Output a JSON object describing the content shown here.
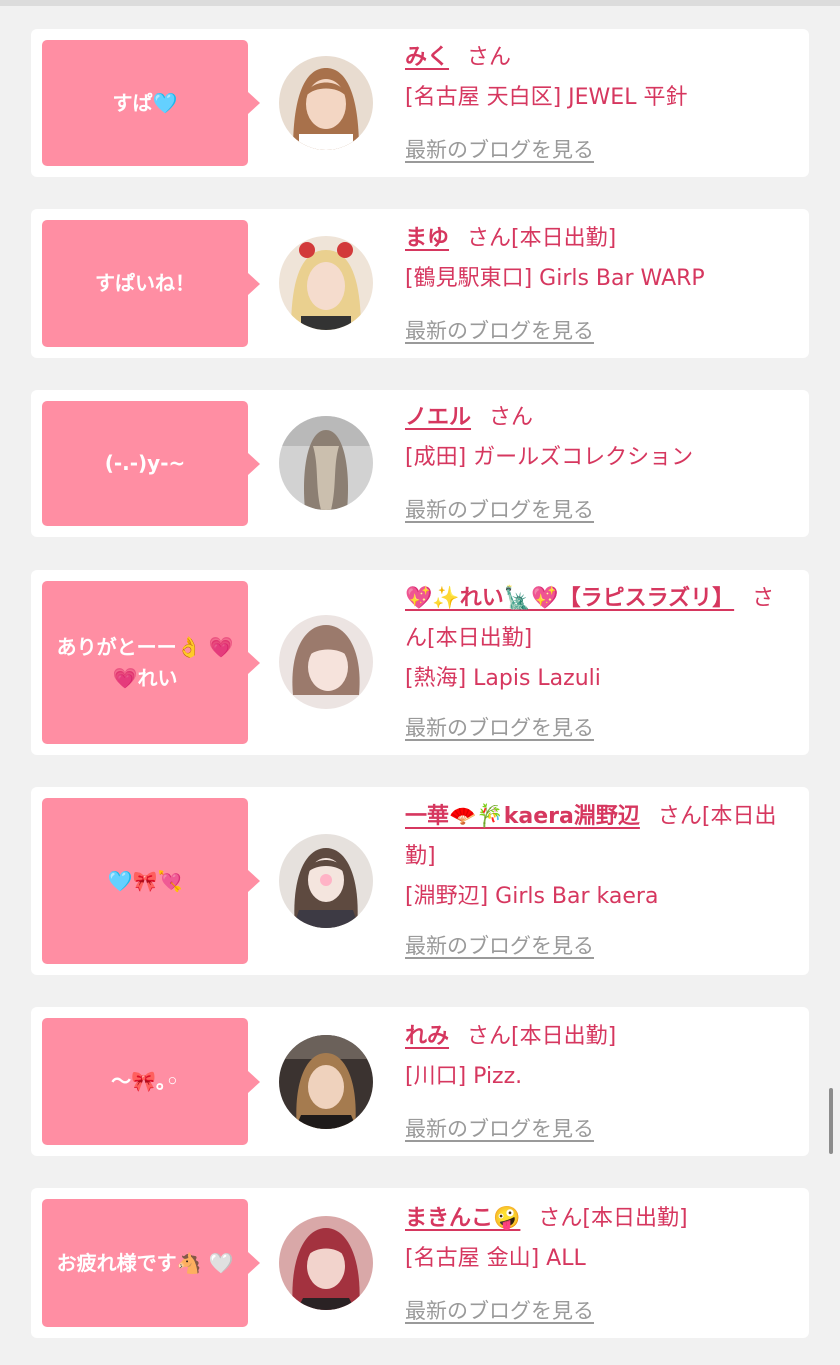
{
  "entries": [
    {
      "message": "すぱ🩵",
      "name": "みく",
      "honorific": "さん",
      "status": "",
      "shop": "[名古屋 天白区] JEWEL 平針",
      "blog_link": "最新のブログを見る",
      "avatar_colors": {
        "bg": "#e8dcd0",
        "hair": "#a8714b",
        "face": "#f3d6c3"
      }
    },
    {
      "message": "すぱいね！",
      "name": "まゆ",
      "honorific": "さん",
      "status": "[本日出勤]",
      "shop": "[鶴見駅東口] Girls Bar WARP",
      "blog_link": "最新のブログを見る",
      "avatar_colors": {
        "bg": "#efe4d8",
        "hair": "#ead08f",
        "face": "#f5dccd"
      }
    },
    {
      "message": "(-.-)y-~",
      "name": "ノエル",
      "honorific": "さん",
      "status": "",
      "shop": "[成田] ガールズコレクション",
      "blog_link": "最新のブログを見る",
      "avatar_colors": {
        "bg": "#d2d2d2",
        "hair": "#8c7f73",
        "face": "#6d625a"
      }
    },
    {
      "message": "ありがとーー👌 💗💗れい",
      "name": "💖✨れい🗽💖【ラピスラズリ】",
      "honorific": "さん",
      "status": "[本日出勤]",
      "shop": "[熱海] Lapis Lazuli",
      "blog_link": "最新のブログを見る",
      "avatar_colors": {
        "bg": "#ece4e2",
        "hair": "#9b7a6c",
        "face": "#f6e3dc"
      }
    },
    {
      "message": "🩵🎀💘",
      "name": "一華🪭🎋kaera淵野辺",
      "honorific": "さん",
      "status": "[本日出勤]",
      "shop": "[淵野辺] Girls Bar kaera",
      "blog_link": "最新のブログを見る",
      "avatar_colors": {
        "bg": "#e6e1dd",
        "hair": "#5e4a40",
        "face": "#f4e5de"
      }
    },
    {
      "message": "〜🎀｡◦",
      "name": "れみ",
      "honorific": "さん",
      "status": "[本日出勤]",
      "shop": "[川口] Pizz.",
      "blog_link": "最新のブログを見る",
      "avatar_colors": {
        "bg": "#3b3330",
        "hair": "#a57b4f",
        "face": "#efd2bd"
      }
    },
    {
      "message": "お疲れ様です🐴 🤍",
      "name": "まきんこ🤪",
      "honorific": "さん",
      "status": "[本日出勤]",
      "shop": "[名古屋 金山] ALL",
      "blog_link": "最新のブログを見る",
      "avatar_colors": {
        "bg": "#d9a8a8",
        "hair": "#a3323f",
        "face": "#f2d3cc"
      }
    }
  ]
}
